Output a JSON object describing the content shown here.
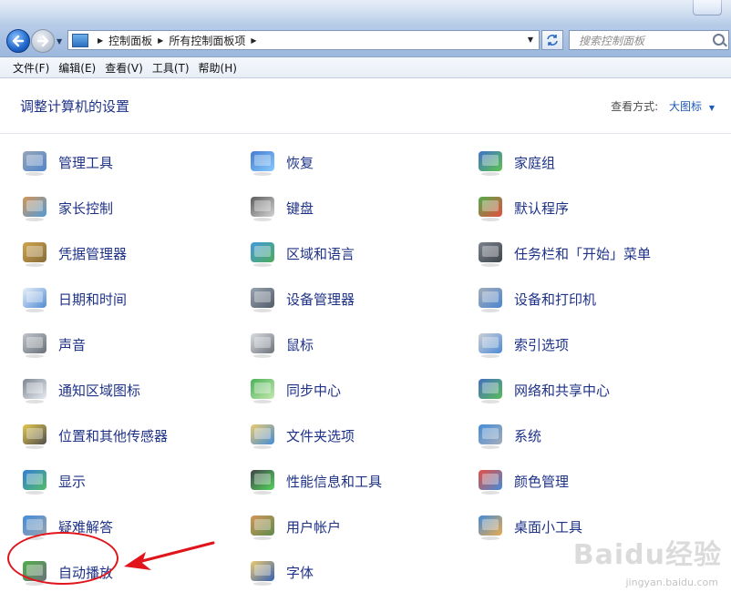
{
  "address": {
    "crumbs": [
      "控制面板",
      "所有控制面板项"
    ]
  },
  "search": {
    "placeholder": "搜索控制面板"
  },
  "menu": [
    "文件(F)",
    "编辑(E)",
    "查看(V)",
    "工具(T)",
    "帮助(H)"
  ],
  "content": {
    "heading": "调整计算机的设置",
    "view_by_label": "查看方式:",
    "view_by_value": "大图标"
  },
  "items": [
    {
      "label": "管理工具",
      "icon": "admin-tools-icon",
      "colors": [
        "#8a9bb0",
        "#3d78c6"
      ]
    },
    {
      "label": "恢复",
      "icon": "recovery-icon",
      "colors": [
        "#2f6fc8",
        "#7bc3ff"
      ]
    },
    {
      "label": "家庭组",
      "icon": "homegroup-icon",
      "colors": [
        "#2b62c2",
        "#4cbc3c"
      ]
    },
    {
      "label": "家长控制",
      "icon": "parental-controls-icon",
      "colors": [
        "#d08a44",
        "#3c8fd6"
      ]
    },
    {
      "label": "键盘",
      "icon": "keyboard-icon",
      "colors": [
        "#4a4a4a",
        "#cfcfcf"
      ]
    },
    {
      "label": "默认程序",
      "icon": "default-programs-icon",
      "colors": [
        "#3fa536",
        "#e1392b"
      ]
    },
    {
      "label": "凭据管理器",
      "icon": "credential-manager-icon",
      "colors": [
        "#c99a3a",
        "#7a5a22"
      ]
    },
    {
      "label": "区域和语言",
      "icon": "region-language-icon",
      "colors": [
        "#2e8fd8",
        "#3aa14a"
      ]
    },
    {
      "label": "任务栏和「开始」菜单",
      "icon": "taskbar-start-icon",
      "colors": [
        "#6c7480",
        "#2a3038"
      ]
    },
    {
      "label": "日期和时间",
      "icon": "date-time-icon",
      "colors": [
        "#e8eef8",
        "#3b7fd0"
      ]
    },
    {
      "label": "设备管理器",
      "icon": "device-manager-icon",
      "colors": [
        "#8d99a8",
        "#3f4a58"
      ]
    },
    {
      "label": "设备和打印机",
      "icon": "devices-printers-icon",
      "colors": [
        "#9aa4b2",
        "#3778c9"
      ]
    },
    {
      "label": "声音",
      "icon": "sound-icon",
      "colors": [
        "#b9bec6",
        "#5a616b"
      ]
    },
    {
      "label": "鼠标",
      "icon": "mouse-icon",
      "colors": [
        "#d6d9de",
        "#5c636c"
      ]
    },
    {
      "label": "索引选项",
      "icon": "indexing-options-icon",
      "colors": [
        "#c5cad2",
        "#3a7ecf"
      ]
    },
    {
      "label": "通知区域图标",
      "icon": "notification-icons-icon",
      "colors": [
        "#6e7886",
        "#e6eaf0"
      ]
    },
    {
      "label": "同步中心",
      "icon": "sync-center-icon",
      "colors": [
        "#34a845",
        "#bfe7a7"
      ]
    },
    {
      "label": "网络和共享中心",
      "icon": "network-sharing-icon",
      "colors": [
        "#2f5fb8",
        "#47b44a"
      ]
    },
    {
      "label": "位置和其他传感器",
      "icon": "location-sensors-icon",
      "colors": [
        "#e2c13a",
        "#3b3b3b"
      ]
    },
    {
      "label": "文件夹选项",
      "icon": "folder-options-icon",
      "colors": [
        "#e9c460",
        "#2f7fd3"
      ]
    },
    {
      "label": "系统",
      "icon": "system-icon",
      "colors": [
        "#2f7fd3",
        "#9aa4b2"
      ]
    },
    {
      "label": "显示",
      "icon": "display-icon",
      "colors": [
        "#1e6fd0",
        "#3fb55a"
      ]
    },
    {
      "label": "性能信息和工具",
      "icon": "performance-icon",
      "colors": [
        "#2a2f35",
        "#3fd04a"
      ]
    },
    {
      "label": "颜色管理",
      "icon": "color-management-icon",
      "colors": [
        "#e23b2e",
        "#2f7fd3"
      ]
    },
    {
      "label": "疑难解答",
      "icon": "troubleshooting-icon",
      "colors": [
        "#2f7fd3",
        "#8d99a8"
      ]
    },
    {
      "label": "用户帐户",
      "icon": "user-accounts-icon",
      "colors": [
        "#d08a44",
        "#4a7f3a"
      ]
    },
    {
      "label": "桌面小工具",
      "icon": "desktop-gadgets-icon",
      "colors": [
        "#2f7fd3",
        "#e8a13a"
      ]
    },
    {
      "label": "自动播放",
      "icon": "autoplay-icon",
      "colors": [
        "#3fa536",
        "#5a616b"
      ]
    },
    {
      "label": "字体",
      "icon": "fonts-icon",
      "colors": [
        "#e9c460",
        "#1f4fa8"
      ]
    }
  ],
  "watermark": {
    "logo": "Baidu经验",
    "url": "jingyan.baidu.com"
  },
  "annotation": {
    "color": "#e0141a"
  }
}
